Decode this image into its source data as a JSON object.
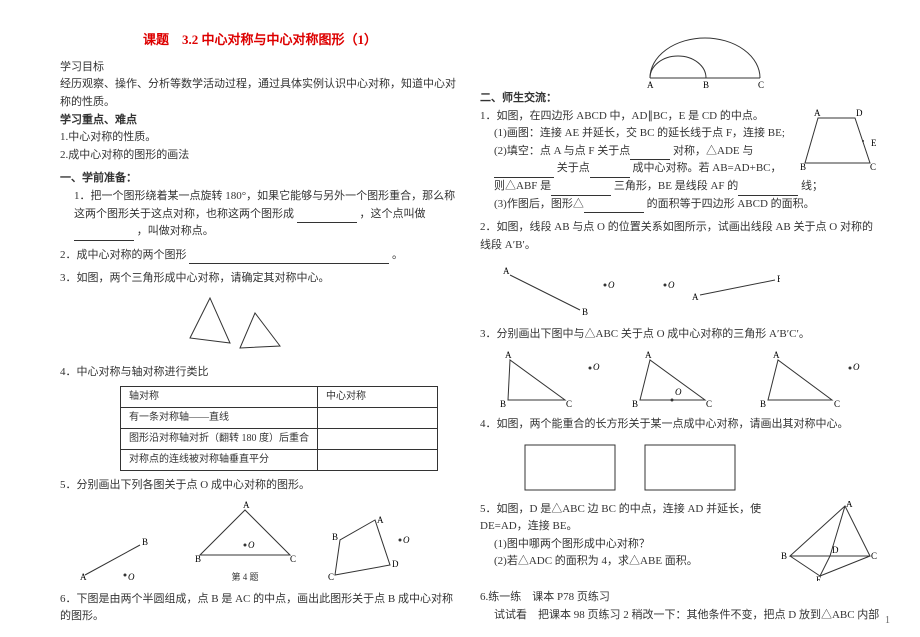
{
  "title": "课题　3.2 中心对称与中心对称图形（1）",
  "objective_label": "学习目标",
  "objective_text": "经历观察、操作、分析等数学活动过程，通过具体实例认识中心对称，知道中心对称的性质。",
  "keypoints_label": "学习重点、难点",
  "keypoint1": "1.中心对称的性质。",
  "keypoint2": "2.成中心对称的图形的画法",
  "section1_label": "一、学前准备：",
  "q1": "1．把一个图形绕着某一点旋转 180°，如果它能够与另外一个图形重合，那么称这两个图形关于这点对称，也称这两个图形成",
  "q1_suffix": "，这个点叫做",
  "q1_suffix2": "，叫做对称点。",
  "q2": "2．成中心对称的两个图形",
  "q2_end": "。",
  "q3": "3．如图，两个三角形成中心对称，请确定其对称中心。",
  "q4": "4．中心对称与轴对称进行类比",
  "table": {
    "header1": "轴对称",
    "header2": "中心对称",
    "r1c1": "有一条对称轴——直线",
    "r2c1": "图形沿对称轴对折（翻转 180 度）后重合",
    "r3c1": "对称点的连线被对称轴垂直平分"
  },
  "q5": "5．分别画出下列各图关于点 O 成中心对称的图形。",
  "fig5_caption": "第 4 题",
  "q6": "6．下图是由两个半圆组成，点 B 是 AC 的中点，画出此图形关于点 B 成中心对称的图形。",
  "section2_label": "二、师生交流：",
  "r1": "1．如图，在四边形 ABCD 中，AD∥BC，E 是 CD 的中点。",
  "r1_1": "(1)画图：连接 AE 并延长，交 BC 的延长线于点 F，连接 BE;",
  "r1_2": "(2)填空：点 A 与点 F 关于点",
  "r1_2b": "对称，△ADE 与",
  "r1_2c": "关于点",
  "r1_2d": "成中心对称。若 AB=AD+BC，则△ABF 是",
  "r1_2e": "三角形，BE 是线段 AF 的",
  "r1_2f": "线；",
  "r1_3": "(3)作图后，图形△",
  "r1_3b": "的面积等于四边形 ABCD 的面积。",
  "r2": "2．如图，线段 AB 与点 O 的位置关系如图所示，试画出线段 AB 关于点 O 对称的线段 A′B′。",
  "r3": "3．分别画出下图中与△ABC 关于点 O 成中心对称的三角形 A′B′C′。",
  "r4": "4．如图，两个能重合的长方形关于某一点成中心对称，请画出其对称中心。",
  "r5": "5．如图，D 是△ABC 边 BC 的中点，连接 AD 并延长，使 DE=AD，连接 BE。",
  "r5_1": "(1)图中哪两个图形成中心对称？",
  "r5_2": "(2)若△ADC 的面积为 4，求△ABE 面积。",
  "r6": "6.练一练　课本 P78 页练习",
  "r6b": "试试看　把课本 98 页练习 2 稍改一下：其他条件不变，把点 D 放到△ABC 内部",
  "labels": {
    "A": "A",
    "B": "B",
    "C": "C",
    "D": "D",
    "E": "E",
    "O": "O"
  },
  "page_num": "1"
}
